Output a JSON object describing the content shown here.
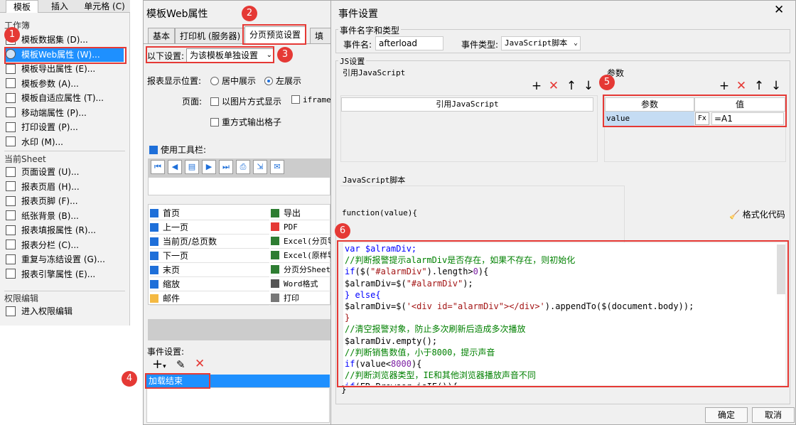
{
  "left_panel": {
    "tabs": [
      "模板",
      "插入",
      "单元格 (C)"
    ],
    "sections": {
      "workbook": "工作簿",
      "sheet": "当前Sheet",
      "permissions": "权限编辑"
    },
    "workbook_items": [
      {
        "label": "模板数据集 (D)...",
        "icon": "database-icon"
      },
      {
        "label": "模板Web属性 (W)...",
        "icon": "globe-icon",
        "selected": true
      },
      {
        "label": "模板导出属性 (E)...",
        "icon": "export-icon"
      },
      {
        "label": "模板参数 (A)...",
        "icon": "parameter-icon"
      },
      {
        "label": "模板自适应属性 (T)...",
        "icon": "adaptive-icon"
      },
      {
        "label": "移动端属性 (P)...",
        "icon": "mobile-icon"
      },
      {
        "label": "打印设置 (P)...",
        "icon": "printer-icon"
      },
      {
        "label": "水印 (M)...",
        "icon": "stamp-icon"
      }
    ],
    "sheet_items": [
      {
        "label": "页面设置 (U)...",
        "icon": "page-setup-icon"
      },
      {
        "label": "报表页眉 (H)...",
        "icon": "header-icon"
      },
      {
        "label": "报表页脚 (F)...",
        "icon": "footer-icon"
      },
      {
        "label": "纸张背景 (B)...",
        "icon": "background-icon"
      },
      {
        "label": "报表填报属性 (R)...",
        "icon": "fill-icon"
      },
      {
        "label": "报表分栏 (C)...",
        "icon": "columns-icon"
      },
      {
        "label": "重复与冻结设置 (G)...",
        "icon": "freeze-icon"
      },
      {
        "label": "报表引擎属性 (E)...",
        "icon": "engine-icon"
      }
    ],
    "permission_items": [
      {
        "label": "进入权限编辑",
        "icon": "permission-icon"
      }
    ]
  },
  "web_window": {
    "title": "模板Web属性",
    "tabs": [
      "基本",
      "打印机 (服务器)",
      "分页预览设置",
      "填报"
    ],
    "settings_label": "以下设置:",
    "settings_value": "为该模板单独设置",
    "display_position_label": "报表显示位置:",
    "position_options": [
      "居中展示",
      "左展示"
    ],
    "page_label": "页面:",
    "page_options": [
      "以图片方式显示",
      "iframe"
    ],
    "output_option": "重方式输出格子",
    "toolbar_checkbox": "使用工具栏:",
    "toolbar_buttons": [
      {
        "name": "first-page-icon",
        "glyph": "⏮"
      },
      {
        "name": "prev-page-icon",
        "glyph": "◀"
      },
      {
        "name": "page-count-icon",
        "glyph": "▤"
      },
      {
        "name": "next-page-icon",
        "glyph": "▶"
      },
      {
        "name": "last-page-icon",
        "glyph": "⏭"
      },
      {
        "name": "print-icon",
        "glyph": "⎙"
      },
      {
        "name": "export-icon",
        "glyph": "⇲"
      },
      {
        "name": "mail-icon",
        "glyph": "✉"
      }
    ],
    "buttons_left": [
      "首页",
      "上一页",
      "当前页/总页数",
      "下一页",
      "末页",
      "缩放",
      "邮件"
    ],
    "buttons_right": [
      "导出",
      "PDF",
      "Excel(分页导",
      "Excel(原样导",
      "分页分Sheet",
      "Word格式",
      "打印"
    ],
    "event_label": "事件设置:",
    "event_item": "加载结束"
  },
  "event_dialog": {
    "title": "事件设置",
    "group_name_type": "事件名字和类型",
    "event_name_label": "事件名:",
    "event_name_value": "afterload",
    "event_type_label": "事件类型:",
    "event_type_value": "JavaScript脚本",
    "js_settings_label": "JS设置",
    "ref_js_label": "引用JavaScript",
    "ref_js_column": "引用JavaScript",
    "params_label": "参数",
    "param_col": "参数",
    "value_col": "值",
    "param_name": "value",
    "param_value": "=A1",
    "script_label": "JavaScript脚本",
    "function_header": "function(value){",
    "format_code": "格式化代码",
    "closing_brace": "}",
    "ok": "确定",
    "cancel": "取消",
    "code_lines": [
      {
        "text": "var $alramDiv;",
        "cls": "kw"
      },
      {
        "text": "//判断报警提示alarmDiv是否存在，如果不存在，则初始化",
        "cls": "cm"
      },
      {
        "text": "if($(\"#alarmDiv\").length>0){",
        "cls": "mix1"
      },
      {
        "text": "$alramDiv=$(\"#alarmDiv\");",
        "cls": "mix2"
      },
      {
        "text": "} else{",
        "cls": "kw"
      },
      {
        "text": "$alramDiv=$('<div id=\"alarmDiv\"></div>').appendTo($(document.body));",
        "cls": "mix3"
      },
      {
        "text": "}",
        "cls": "st"
      },
      {
        "text": "//清空报警对象，防止多次刷新后造成多次播放",
        "cls": "cm"
      },
      {
        "text": "$alramDiv.empty();",
        "cls": "plain"
      },
      {
        "text": "//判断销售数值，小于8000，提示声音",
        "cls": "cm"
      },
      {
        "text": "if(value<8000){",
        "cls": "mix4"
      },
      {
        "text": "//判断浏览器类型，IE和其他浏览器播放声音不同",
        "cls": "cm"
      },
      {
        "text": "if(FR.Browser.isIE()){",
        "cls": "mix5"
      }
    ]
  },
  "badges": [
    "1",
    "2",
    "3",
    "4",
    "5",
    "6"
  ],
  "colors": {
    "accent": "#1e90ff",
    "highlight": "#e53935"
  }
}
